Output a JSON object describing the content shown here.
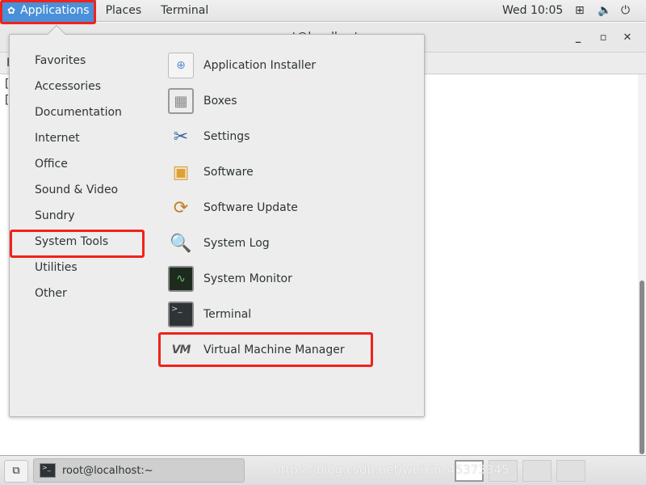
{
  "topbar": {
    "applications": "Applications",
    "places": "Places",
    "terminal": "Terminal",
    "clock": "Wed 10:05",
    "icons": [
      "network-icon",
      "volume-icon",
      "power-icon"
    ]
  },
  "window": {
    "title": "root@localhost:~",
    "menu_first": "F",
    "lines": [
      "[",
      "["
    ],
    "controls": [
      "minimize",
      "maximize",
      "close"
    ]
  },
  "menu": {
    "categories": [
      "Favorites",
      "Accessories",
      "Documentation",
      "Internet",
      "Office",
      "Sound & Video",
      "Sundry",
      "System Tools",
      "Utilities",
      "Other"
    ],
    "selected_category": "System Tools",
    "apps": [
      "Application Installer",
      "Boxes",
      "Settings",
      "Software",
      "Software Update",
      "System Log",
      "System Monitor",
      "Terminal",
      "Virtual Machine Manager"
    ]
  },
  "taskbar": {
    "task": "root@localhost:~"
  },
  "watermark": "https://blog.csdn.net/weixin_45373345",
  "colors": {
    "highlight": "#4a90d9",
    "annotation": "#f0221c"
  }
}
